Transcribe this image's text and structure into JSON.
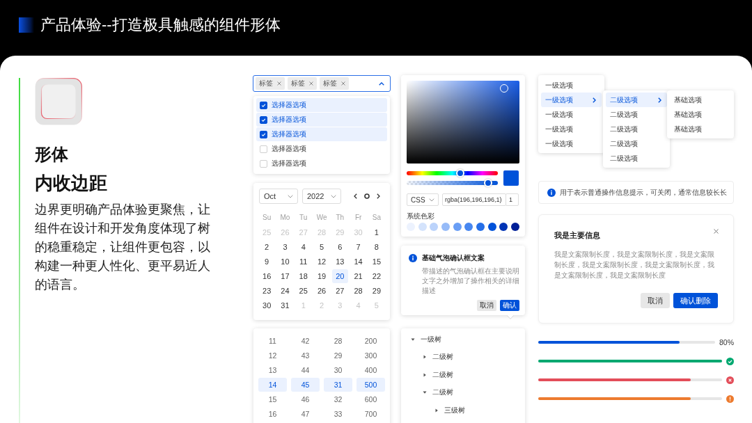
{
  "header": {
    "title": "产品体验--打造极具触感的组件形体"
  },
  "intro": {
    "heading": "形体",
    "subheading": "内收边距",
    "body": "边界更明确产品体验更聚焦，让组件在设计和开发角度体现了树的稳重稳定，让组件更包容，以构建一种更人性化、更平易近人的语言。"
  },
  "multi_select": {
    "tags": [
      "标签",
      "标签",
      "标签"
    ],
    "expanded": true,
    "options": [
      {
        "label": "选择器选项",
        "checked": true
      },
      {
        "label": "选择器选项",
        "checked": true
      },
      {
        "label": "选择器选项",
        "checked": true
      },
      {
        "label": "选择器选项",
        "checked": false
      },
      {
        "label": "选择器选项",
        "checked": false
      }
    ]
  },
  "calendar": {
    "month": "Oct",
    "year": "2022",
    "weekdays": [
      "Su",
      "Mo",
      "Tu",
      "We",
      "Th",
      "Fr",
      "Sa"
    ],
    "days": [
      {
        "label": "25",
        "outside": true,
        "selected": false
      },
      {
        "label": "26",
        "outside": true,
        "selected": false
      },
      {
        "label": "27",
        "outside": true,
        "selected": false
      },
      {
        "label": "28",
        "outside": true,
        "selected": false
      },
      {
        "label": "29",
        "outside": true,
        "selected": false
      },
      {
        "label": "30",
        "outside": true,
        "selected": false
      },
      {
        "label": "1",
        "outside": false,
        "selected": false
      },
      {
        "label": "2",
        "outside": false,
        "selected": false
      },
      {
        "label": "3",
        "outside": false,
        "selected": false
      },
      {
        "label": "4",
        "outside": false,
        "selected": false
      },
      {
        "label": "5",
        "outside": false,
        "selected": false
      },
      {
        "label": "6",
        "outside": false,
        "selected": false
      },
      {
        "label": "7",
        "outside": false,
        "selected": false
      },
      {
        "label": "8",
        "outside": false,
        "selected": false
      },
      {
        "label": "9",
        "outside": false,
        "selected": false
      },
      {
        "label": "10",
        "outside": false,
        "selected": false
      },
      {
        "label": "11",
        "outside": false,
        "selected": false
      },
      {
        "label": "12",
        "outside": false,
        "selected": false
      },
      {
        "label": "13",
        "outside": false,
        "selected": false
      },
      {
        "label": "14",
        "outside": false,
        "selected": false
      },
      {
        "label": "15",
        "outside": false,
        "selected": false
      },
      {
        "label": "16",
        "outside": false,
        "selected": false
      },
      {
        "label": "17",
        "outside": false,
        "selected": false
      },
      {
        "label": "18",
        "outside": false,
        "selected": false
      },
      {
        "label": "19",
        "outside": false,
        "selected": false
      },
      {
        "label": "20",
        "outside": false,
        "selected": true
      },
      {
        "label": "21",
        "outside": false,
        "selected": false
      },
      {
        "label": "22",
        "outside": false,
        "selected": false
      },
      {
        "label": "23",
        "outside": false,
        "selected": false
      },
      {
        "label": "24",
        "outside": false,
        "selected": false
      },
      {
        "label": "25",
        "outside": false,
        "selected": false
      },
      {
        "label": "26",
        "outside": false,
        "selected": false
      },
      {
        "label": "27",
        "outside": false,
        "selected": false
      },
      {
        "label": "28",
        "outside": false,
        "selected": false
      },
      {
        "label": "29",
        "outside": false,
        "selected": false
      },
      {
        "label": "30",
        "outside": false,
        "selected": false
      },
      {
        "label": "31",
        "outside": false,
        "selected": false
      },
      {
        "label": "1",
        "outside": true,
        "selected": false
      },
      {
        "label": "2",
        "outside": true,
        "selected": false
      },
      {
        "label": "3",
        "outside": true,
        "selected": false
      },
      {
        "label": "4",
        "outside": true,
        "selected": false
      },
      {
        "label": "5",
        "outside": true,
        "selected": false
      }
    ]
  },
  "number_picker": {
    "columns": [
      {
        "items": [
          {
            "label": "11",
            "selected": false
          },
          {
            "label": "12",
            "selected": false
          },
          {
            "label": "13",
            "selected": false
          },
          {
            "label": "14",
            "selected": true
          },
          {
            "label": "15",
            "selected": false
          },
          {
            "label": "16",
            "selected": false
          }
        ]
      },
      {
        "items": [
          {
            "label": "42",
            "selected": false
          },
          {
            "label": "43",
            "selected": false
          },
          {
            "label": "44",
            "selected": false
          },
          {
            "label": "45",
            "selected": true
          },
          {
            "label": "46",
            "selected": false
          },
          {
            "label": "47",
            "selected": false
          }
        ]
      },
      {
        "items": [
          {
            "label": "28",
            "selected": false
          },
          {
            "label": "29",
            "selected": false
          },
          {
            "label": "30",
            "selected": false
          },
          {
            "label": "31",
            "selected": true
          },
          {
            "label": "32",
            "selected": false
          },
          {
            "label": "33",
            "selected": false
          }
        ]
      },
      {
        "items": [
          {
            "label": "200",
            "selected": false
          },
          {
            "label": "300",
            "selected": false
          },
          {
            "label": "400",
            "selected": false
          },
          {
            "label": "500",
            "selected": true
          },
          {
            "label": "600",
            "selected": false
          },
          {
            "label": "700",
            "selected": false
          }
        ]
      }
    ]
  },
  "color_picker": {
    "hue_slider": {
      "level": 0.59
    },
    "alpha_slider": {
      "level": 0.89
    },
    "format": "CSS",
    "value": "rgba(196,196,196,1)",
    "alpha": "1",
    "palette_label": "系统色彩",
    "swatches": [
      {
        "color": "#ecf2fe"
      },
      {
        "color": "#d4e3fc"
      },
      {
        "color": "#bbd3fb"
      },
      {
        "color": "#96bbf8"
      },
      {
        "color": "#699ef5"
      },
      {
        "color": "#4787f0"
      },
      {
        "color": "#266fe8"
      },
      {
        "color": "#0052d9"
      },
      {
        "color": "#0034b5"
      },
      {
        "color": "#001f97"
      }
    ]
  },
  "popconfirm": {
    "title": "基础气泡确认框文案",
    "description": "带描述的气泡确认框在主要说明文字之外增加了操作相关的详细描述",
    "buttons": [
      {
        "label": "取消",
        "kind": "secondary"
      },
      {
        "label": "确认",
        "kind": "primary"
      }
    ]
  },
  "tree": {
    "nodes": [
      {
        "label": "一级树",
        "expanded": true,
        "children": [
          {
            "label": "二级树",
            "expanded": false
          },
          {
            "label": "二级树",
            "expanded": false
          },
          {
            "label": "二级树",
            "expanded": true,
            "children": [
              {
                "label": "三级树",
                "expanded": false
              }
            ]
          }
        ]
      }
    ]
  },
  "cascader": {
    "menus": [
      {
        "items": [
          {
            "label": "一级选项",
            "selected": false,
            "has_children": false
          },
          {
            "label": "一级选项",
            "selected": true,
            "has_children": true
          },
          {
            "label": "一级选项",
            "selected": false,
            "has_children": false
          },
          {
            "label": "一级选项",
            "selected": false,
            "has_children": false
          },
          {
            "label": "一级选项",
            "selected": false,
            "has_children": false
          }
        ]
      },
      {
        "items": [
          {
            "label": "二级选项",
            "selected": true,
            "has_children": true
          },
          {
            "label": "二级选项",
            "selected": false,
            "has_children": false
          },
          {
            "label": "二级选项",
            "selected": false,
            "has_children": false
          },
          {
            "label": "二级选项",
            "selected": false,
            "has_children": false
          },
          {
            "label": "二级选项",
            "selected": false,
            "has_children": false
          }
        ]
      },
      {
        "items": [
          {
            "label": "基础选项",
            "selected": false,
            "has_children": false
          },
          {
            "label": "基础选项",
            "selected": false,
            "has_children": false
          },
          {
            "label": "基础选项",
            "selected": false,
            "has_children": false
          }
        ]
      }
    ]
  },
  "alert": {
    "text": "用于表示普通操作信息提示，可关闭，通常信息较长长"
  },
  "dialog": {
    "title": "我是主要信息",
    "body": "我是文案限制长度，我是文案限制长度，我是文案限制长度，我是文案限制长度，我是文案限制长度，我是文案限制长度，我是文案限制长度",
    "buttons": [
      {
        "label": "取消",
        "kind": "secondary"
      },
      {
        "label": "确认删除",
        "kind": "primary"
      }
    ]
  },
  "progress": [
    {
      "kind": "percent",
      "color": "#0052d9",
      "level": 0.8,
      "reading": "80%"
    },
    {
      "kind": "success",
      "color": "#00a870",
      "level": 1
    },
    {
      "kind": "error",
      "color": "#e34d59",
      "level": 0.83
    },
    {
      "kind": "warning",
      "color": "#ed7b2f",
      "level": 0.83
    }
  ]
}
